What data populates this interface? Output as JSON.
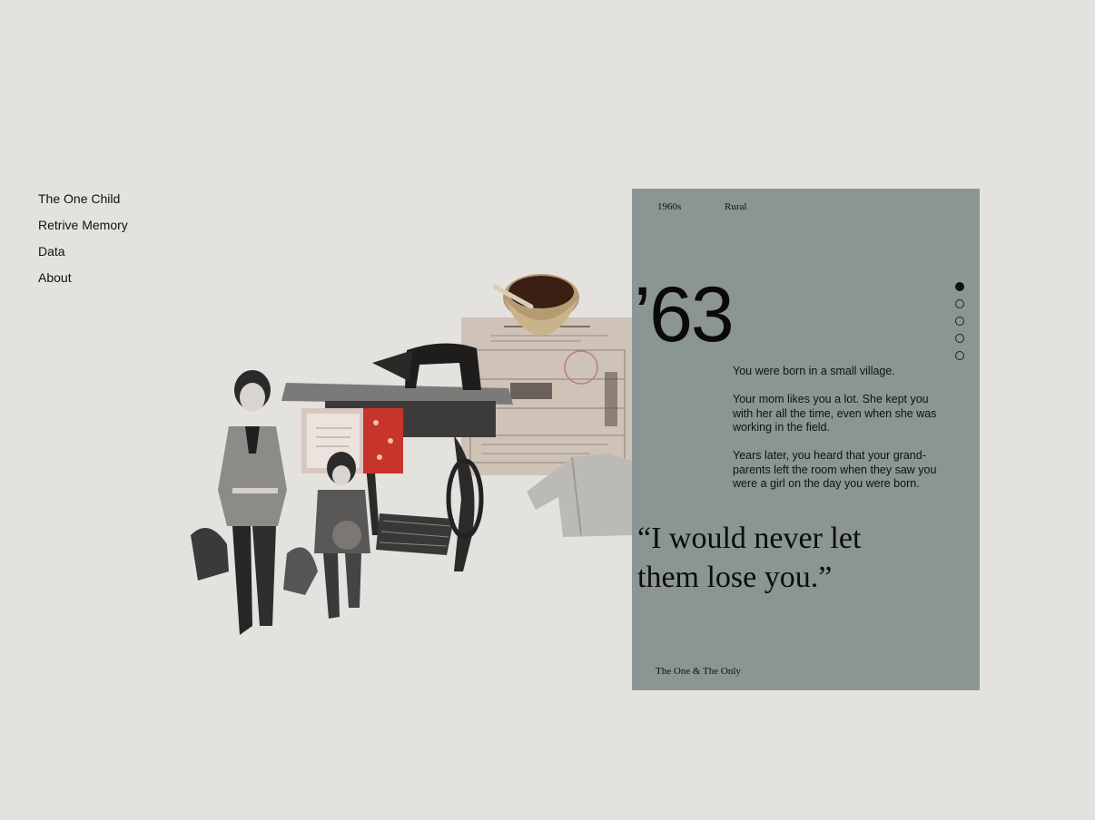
{
  "nav": {
    "items": [
      {
        "label": "The One Child"
      },
      {
        "label": "Retrive Memory"
      },
      {
        "label": "Data"
      },
      {
        "label": "About"
      }
    ]
  },
  "panel": {
    "decade": "1960s",
    "region": "Rural",
    "year": "’63",
    "story": [
      "You were born in a small village.",
      "Your mom likes you a lot. She kept you with her all the time, even when she was working in the field.",
      "Years later, you heard that your grand-parents left the room when they saw you were a girl on the day you were born."
    ],
    "quote": "“I would never let them lose you.”",
    "footer": "The One & The Only",
    "pagination": {
      "total": 5,
      "active": 1
    }
  },
  "collage": {
    "items": [
      "mother-and-child-photo",
      "sewing-machine",
      "birth-certificate",
      "tea-bowl",
      "red-book",
      "knitted-sweater"
    ]
  }
}
